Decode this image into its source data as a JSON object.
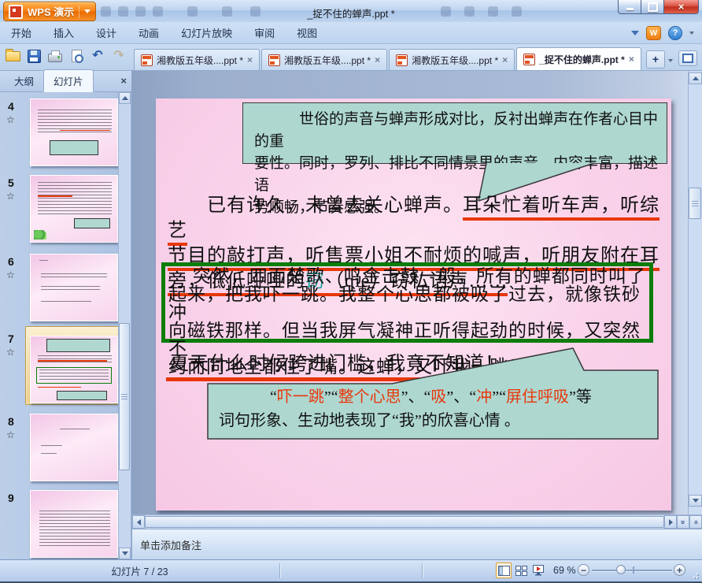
{
  "window": {
    "app_button": "WPS 演示",
    "title": "_捉不住的蝉声.ppt *"
  },
  "menu": {
    "items": [
      "开始",
      "插入",
      "设计",
      "动画",
      "幻灯片放映",
      "审阅",
      "视图"
    ]
  },
  "toolbar": {
    "icons": [
      "open",
      "save",
      "print",
      "print-preview",
      "undo",
      "redo",
      "toolbar-options"
    ]
  },
  "doc_tabs": {
    "tabs": [
      {
        "label": "湘教版五年级....ppt *",
        "active": false
      },
      {
        "label": "湘教版五年级....ppt *",
        "active": false
      },
      {
        "label": "湘教版五年级....ppt *",
        "active": false
      },
      {
        "label": "_捉不住的蝉声.ppt *",
        "active": true
      }
    ],
    "new_tab_label": "+"
  },
  "sidebar": {
    "tabs": {
      "outline": "大纲",
      "slides": "幻灯片"
    },
    "active_tab": "幻灯片",
    "close_label": "×",
    "slides": [
      {
        "number": "4",
        "star": "☆"
      },
      {
        "number": "5",
        "star": "☆"
      },
      {
        "number": "6",
        "star": "☆"
      },
      {
        "number": "7",
        "star": "☆",
        "selected": true
      },
      {
        "number": "8",
        "star": "☆"
      },
      {
        "number": "9",
        "star": ""
      }
    ]
  },
  "slide": {
    "top_callout_lines": [
      "　　　世俗的声音与蝉声形成对比，反衬出蝉声在作者心目中的重",
      "要性。同时，罗列、排比不同情景里的声音，内容丰富，描述语",
      "势顺畅，节奏感强。"
    ],
    "paragraph1_seglines": [
      [
        {
          "t": "　　已有许久，未曾去关心蝉声。"
        },
        {
          "t": "耳朵忙着听车声，听综艺",
          "s": "u"
        }
      ],
      [
        {
          "t": "节目的敲打声，听售票小姐不耐烦的喊声，听朋友附在耳",
          "s": "u"
        }
      ],
      [
        {
          "t": "旁，低低哑哑的",
          "s": "u"
        },
        {
          "t": "窃",
          "s": "u teal"
        },
        {
          "t": "（qiè）窃私语声……",
          "s": "u"
        }
      ]
    ],
    "green_box_lines": [
      "　 突然，四面楚歌、鸣金击鼓一般，所有的蝉都同时叫了",
      "起来，把我吓一跳。我整个心思都被吸了过去，就像铁砂冲",
      "向磁铁那样。但当我屏气凝神正听得起劲的时候，又突然不",
      "约而同地全都住了嘴。这蝉，又吓我一跳！"
    ],
    "summer_line": "夏天什么时候跨进门槛，我竟不知道！",
    "bottom_callout_seglines": [
      [
        {
          "t": "　　　 “"
        },
        {
          "t": "吓一跳",
          "s": "red"
        },
        {
          "t": "”“"
        },
        {
          "t": "整个心思",
          "s": "red"
        },
        {
          "t": "”、“"
        },
        {
          "t": "吸",
          "s": "red"
        },
        {
          "t": "”、“"
        },
        {
          "t": "冲",
          "s": "red"
        },
        {
          "t": "”“"
        },
        {
          "t": "屏住呼吸",
          "s": "red"
        },
        {
          "t": "”等"
        }
      ],
      [
        {
          "t": "词句形象、生动地表现了“我”的欣喜心情 。"
        }
      ]
    ]
  },
  "notes": {
    "placeholder": "单击添加备注"
  },
  "status": {
    "slide_counter": "幻灯片 7 / 23",
    "zoom_level": "69 %"
  },
  "colors": {
    "accent_red": "#e8370b",
    "green_border": "#0a7d0a",
    "callout_teal": "#aed7d0",
    "slide_pink": "#f9d2ea",
    "wps_orange": "#f77f16"
  }
}
